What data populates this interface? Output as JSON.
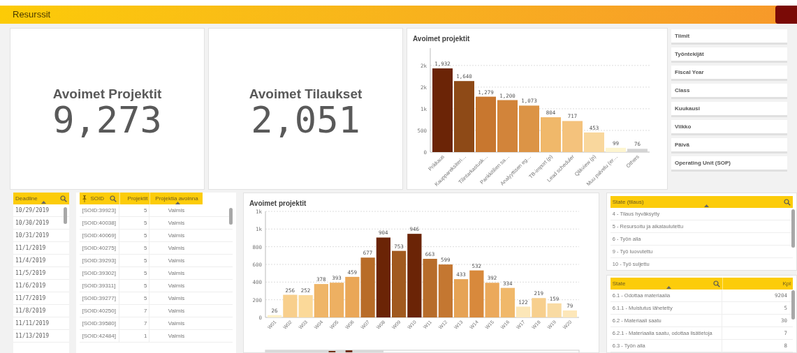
{
  "header": {
    "title": "Resurssit"
  },
  "kpis": [
    {
      "label": "Avoimet Projektit",
      "value": "9,273"
    },
    {
      "label": "Avoimet Tilaukset",
      "value": "2,051"
    }
  ],
  "chart_top": {
    "bars": [
      {
        "color": "#6b2406"
      },
      {
        "color": "#8e4a17"
      },
      {
        "color": "#c8772f"
      },
      {
        "color": "#d2843a"
      },
      {
        "color": "#dc9446"
      },
      {
        "color": "#f0b86a"
      },
      {
        "color": "#f4c27c"
      },
      {
        "color": "#f9d79d"
      },
      {
        "color": "#fdf5d0"
      },
      {
        "color": "#d4d4d4"
      }
    ],
    "chart_data": {
      "type": "bar",
      "title": "Avoimet projektit",
      "categories": [
        "Prikkaus",
        "Kauppareksiteri…",
        "Tilintarkastusk…",
        "Pankkitilien sa…",
        "Analyyttisen eg…",
        "TB-import (p)",
        "Lead scheduler",
        "Qlikview (p)",
        "Muu palvelu (er…",
        "Others"
      ],
      "series": [
        {
          "values": [
            1932,
            1640,
            1279,
            1200,
            1073,
            804,
            717,
            453,
            99,
            76
          ]
        }
      ],
      "value_labels": [
        "1,932",
        "1,640",
        "1,279",
        "1,200",
        "1,073",
        "804",
        "717",
        "453",
        "99",
        "76"
      ],
      "grid": true,
      "ylim": [
        0,
        2400
      ],
      "yticks": [
        0,
        500,
        {
          "value": 1000,
          "label": "1k"
        },
        {
          "value": 1500,
          "label": "2k"
        },
        {
          "value": 2000,
          "label": "2k"
        }
      ]
    }
  },
  "filters": [
    {
      "label": "Tiimit"
    },
    {
      "label": "Työntekijät"
    },
    {
      "label": "Fiscal Year"
    },
    {
      "label": "Class"
    },
    {
      "label": "Kuukausi"
    },
    {
      "label": "Viikko"
    },
    {
      "label": "Päivä"
    },
    {
      "label": "Operating Unit (SOP)"
    }
  ],
  "deadline_table": {
    "header": "Deadline",
    "rows": [
      "10/29/2019",
      "10/30/2019",
      "10/31/2019",
      "11/1/2019",
      "11/4/2019",
      "11/5/2019",
      "11/6/2019",
      "11/7/2019",
      "11/8/2019",
      "11/11/2019",
      "11/13/2019"
    ]
  },
  "soid_table": {
    "columns": [
      "SOID",
      "Projektit",
      "Projektia avoinna"
    ],
    "rows": [
      [
        "[SOID:39923]",
        "5",
        "Valmis"
      ],
      [
        "[SOID:40038]",
        "5",
        "Valmis"
      ],
      [
        "[SOID:40069]",
        "5",
        "Valmis"
      ],
      [
        "[SOID:40275]",
        "5",
        "Valmis"
      ],
      [
        "[SOID:39293]",
        "5",
        "Valmis"
      ],
      [
        "[SOID:39302]",
        "5",
        "Valmis"
      ],
      [
        "[SOID:39311]",
        "5",
        "Valmis"
      ],
      [
        "[SOID:39277]",
        "5",
        "Valmis"
      ],
      [
        "[SOID:40250]",
        "7",
        "Valmis"
      ],
      [
        "[SOID:39580]",
        "7",
        "Valmis"
      ],
      [
        "[SOID:42484]",
        "1",
        "Valmis"
      ]
    ]
  },
  "chart_weeks": {
    "bars": [
      {
        "color": "#fdf0c8"
      },
      {
        "color": "#f8cf8c"
      },
      {
        "color": "#fbd999"
      },
      {
        "color": "#efb567"
      },
      {
        "color": "#edb062"
      },
      {
        "color": "#eaa757"
      },
      {
        "color": "#b86c28"
      },
      {
        "color": "#6b2406"
      },
      {
        "color": "#a15a1f"
      },
      {
        "color": "#6b2406"
      },
      {
        "color": "#b76c2a"
      },
      {
        "color": "#c47731"
      },
      {
        "color": "#e6a355"
      },
      {
        "color": "#d8893c"
      },
      {
        "color": "#eba95b"
      },
      {
        "color": "#f0b86a"
      },
      {
        "color": "#fce7b8"
      },
      {
        "color": "#f7cf8d"
      },
      {
        "color": "#f9dba3"
      },
      {
        "color": "#fde7b9"
      }
    ],
    "chart_data": {
      "type": "bar",
      "title": "Avoimet projektit",
      "categories": [
        "W01",
        "W02",
        "W03",
        "W04",
        "W05",
        "W06",
        "W07",
        "W08",
        "W09",
        "W10",
        "W11",
        "W12",
        "W13",
        "W14",
        "W15",
        "W16",
        "W17",
        "W18",
        "W19",
        "W20"
      ],
      "series": [
        {
          "values": [
            26,
            256,
            252,
            378,
            393,
            459,
            677,
            904,
            753,
            946,
            663,
            599,
            433,
            532,
            392,
            334,
            122,
            219,
            159,
            79
          ]
        }
      ],
      "data_labels": true,
      "grid": true,
      "ylim": [
        0,
        1200
      ],
      "yticks": [
        0,
        200,
        400,
        600,
        800,
        {
          "value": 1000,
          "label": "1k"
        },
        {
          "value": 1200,
          "label": "1k"
        }
      ]
    }
  },
  "state_list": {
    "header": "State (tilaus)",
    "items": [
      "4 - Tilaus hyväksytty",
      "5 - Resursoitu ja aikataulutettu",
      "6 - Työn alla",
      "9 - Työ luovutettu",
      "10 - Työ suljettu"
    ]
  },
  "state_table": {
    "columns": [
      "State",
      "Kpl"
    ],
    "rows": [
      [
        "6.1 - Odottaa materiaalia",
        "9204"
      ],
      [
        "6.1.1 - Muistutus lähetetty",
        "5"
      ],
      [
        "6.2 - Materiaali saatu",
        "30"
      ],
      [
        "6.2.1 - Materiaalia saatu, odottaa lisätietoja",
        "7"
      ],
      [
        "6.3 - Työn alla",
        "8"
      ]
    ]
  }
}
